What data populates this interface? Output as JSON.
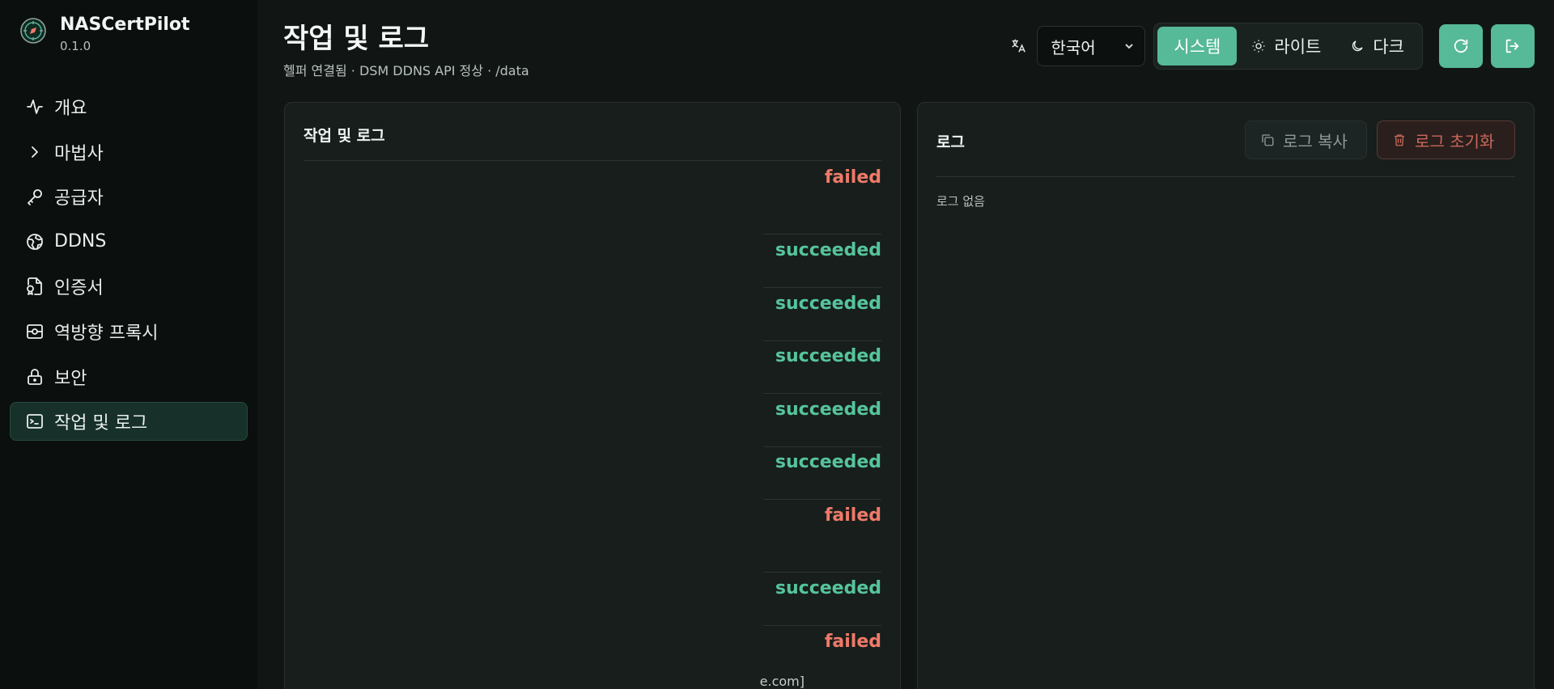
{
  "app": {
    "name": "NASCertPilot",
    "version": "0.1.0"
  },
  "sidebar": {
    "items": [
      {
        "label": "개요",
        "icon": "activity-icon"
      },
      {
        "label": "마법사",
        "icon": "chevron-right-icon"
      },
      {
        "label": "공급자",
        "icon": "key-icon"
      },
      {
        "label": "DDNS",
        "icon": "globe-icon"
      },
      {
        "label": "인증서",
        "icon": "file-badge-icon"
      },
      {
        "label": "역방향 프록시",
        "icon": "proxy-icon"
      },
      {
        "label": "보안",
        "icon": "lock-icon"
      },
      {
        "label": "작업 및 로그",
        "icon": "terminal-icon",
        "active": true
      }
    ]
  },
  "header": {
    "title": "작업 및 로그",
    "subtitle": "헬퍼 연결됨 · DSM DDNS API 정상 · /data"
  },
  "toolbar": {
    "language_icon": "translate-icon",
    "language": "한국어",
    "themes": [
      {
        "label": "시스템",
        "active": true
      },
      {
        "label": "라이트",
        "icon": "sun-icon"
      },
      {
        "label": "다크",
        "icon": "moon-icon"
      }
    ],
    "refresh_icon": "refresh-icon",
    "logout_icon": "logout-icon"
  },
  "jobs_panel": {
    "title": "작업 및 로그",
    "jobs": [
      {
        "status": "failed"
      },
      {
        "status": "succeeded"
      },
      {
        "status": "succeeded"
      },
      {
        "status": "succeeded"
      },
      {
        "status": "succeeded"
      },
      {
        "status": "succeeded"
      },
      {
        "status": "failed"
      },
      {
        "status": "succeeded"
      },
      {
        "status": "failed"
      }
    ],
    "truncated_text": "e.com]"
  },
  "logs_panel": {
    "title": "로그",
    "copy_label": "로그 복사",
    "clear_label": "로그 초기화",
    "empty_text": "로그 없음"
  },
  "colors": {
    "accent": "#56b998",
    "success": "#56c49c",
    "failure": "#ef7a69",
    "background": "#111615"
  }
}
